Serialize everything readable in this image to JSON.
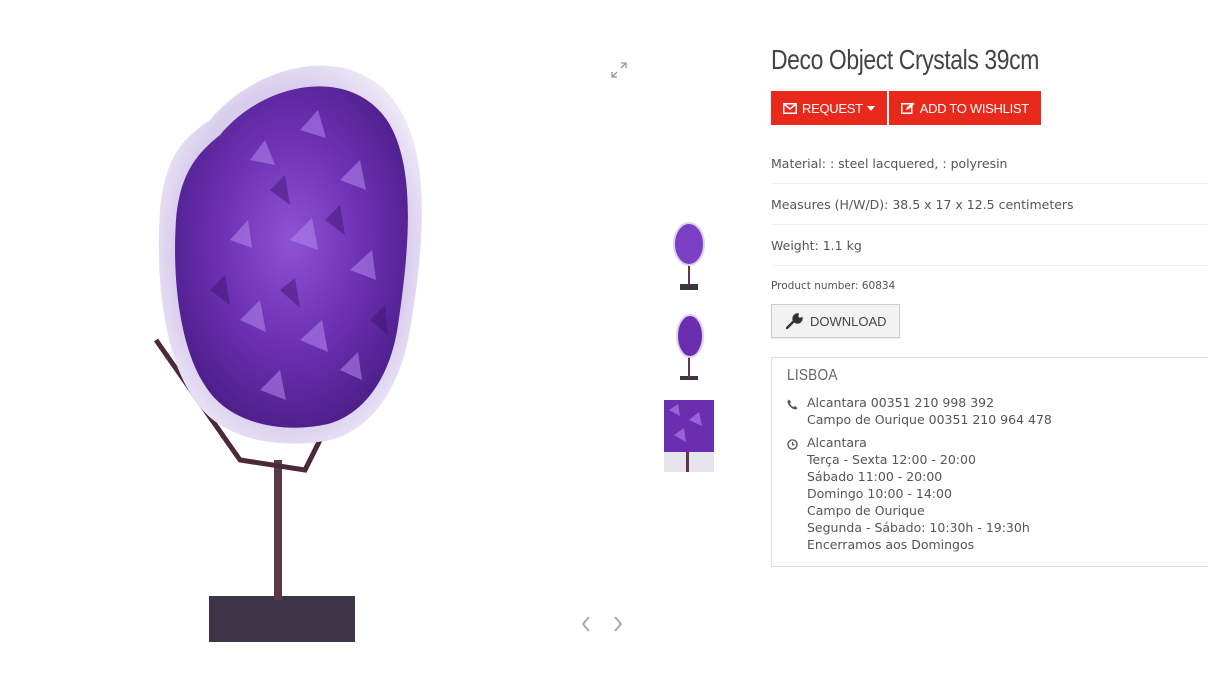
{
  "product": {
    "title": "Deco Object Crystals 39cm",
    "image_alt": "Amethyst crystal cluster on metal stand"
  },
  "buttons": {
    "request_label": "REQUEST",
    "wishlist_label": "ADD TO WISHLIST",
    "download_label": "DOWNLOAD"
  },
  "specs": {
    "material": "Material: : steel lacquered, : polyresin",
    "measures": "Measures (H/W/D): 38.5 x 17 x 12.5 centimeters",
    "weight": "Weight: 1.1 kg",
    "product_number": "Product number: 60834"
  },
  "store": {
    "name": "LISBOA",
    "phones": [
      "Alcantara 00351 210 998 392",
      "Campo de Ourique 00351 210 964 478"
    ],
    "hours": [
      "Alcantara",
      "Terça - Sexta 12:00 - 20:00",
      "Sábado 11:00 - 20:00",
      "Domingo 10:00 - 14:00",
      "Campo de Ourique",
      "Segunda - Sábado: 10:30h - 19:30h",
      "Encerramos aos Domingos"
    ]
  },
  "colors": {
    "accent": "#e8291c",
    "amethyst": "#6a2fb0"
  },
  "icons": {
    "zoom": "expand-icon",
    "prev": "chevron-left-icon",
    "next": "chevron-right-icon",
    "request": "envelope-icon",
    "wishlist": "edit-icon",
    "download": "wrench-icon",
    "phone": "phone-icon",
    "clock": "clock-icon"
  }
}
